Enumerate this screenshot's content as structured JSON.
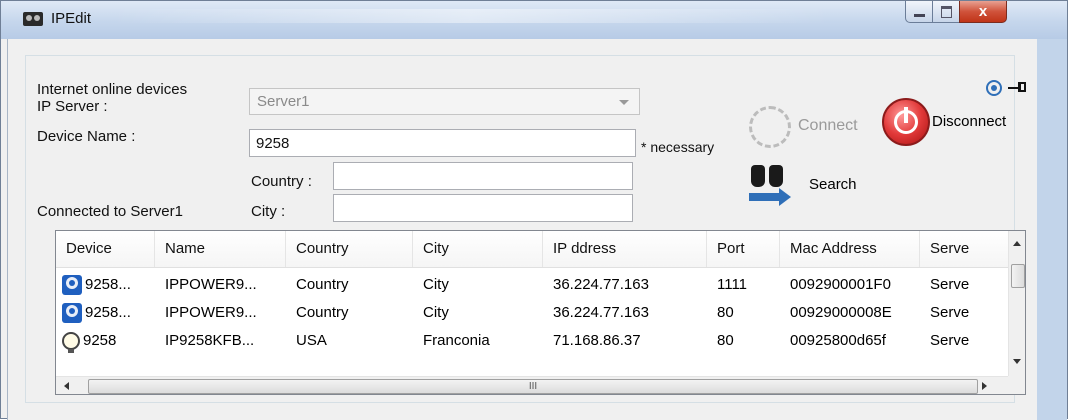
{
  "window": {
    "title": "IPEdit",
    "close_label": "x"
  },
  "form": {
    "group_label": "Internet online devices",
    "ip_server_label": "IP Server :",
    "ip_server_value": "Server1",
    "device_name_label": "Device Name :",
    "device_name_value": "9258",
    "necessary_note": "* necessary",
    "country_label": "Country :",
    "country_value": "",
    "city_label": "City :",
    "city_value": "",
    "status": "Connected to Server1"
  },
  "actions": {
    "connect_label": "Connect",
    "disconnect_label": "Disconnect",
    "search_label": "Search"
  },
  "table": {
    "columns": [
      "Device",
      "Name",
      "Country",
      "City",
      "IP ddress",
      "Port",
      "Mac Address",
      "Serve"
    ],
    "rows": [
      {
        "icon": "network-device-icon",
        "device": "9258...",
        "name": "IPPOWER9...",
        "country": "Country",
        "city": "City",
        "ip": "36.224.77.163",
        "port": "1111",
        "mac": "0092900001F0",
        "server": "Serve"
      },
      {
        "icon": "network-device-icon",
        "device": "9258...",
        "name": "IPPOWER9...",
        "country": "Country",
        "city": "City",
        "ip": "36.224.77.163",
        "port": "80",
        "mac": "00929000008E",
        "server": "Serve"
      },
      {
        "icon": "lightbulb-icon",
        "device": "9258",
        "name": "IP9258KFB...",
        "country": "USA",
        "city": "Franconia",
        "ip": "71.168.86.37",
        "port": "80",
        "mac": "00925800d65f",
        "server": "Serve"
      }
    ],
    "hscroll_grip": "III"
  },
  "colors": {
    "titlebar": "#c5d6ec",
    "disconnect": "#e23a3a",
    "accent": "#2f6fb8"
  }
}
